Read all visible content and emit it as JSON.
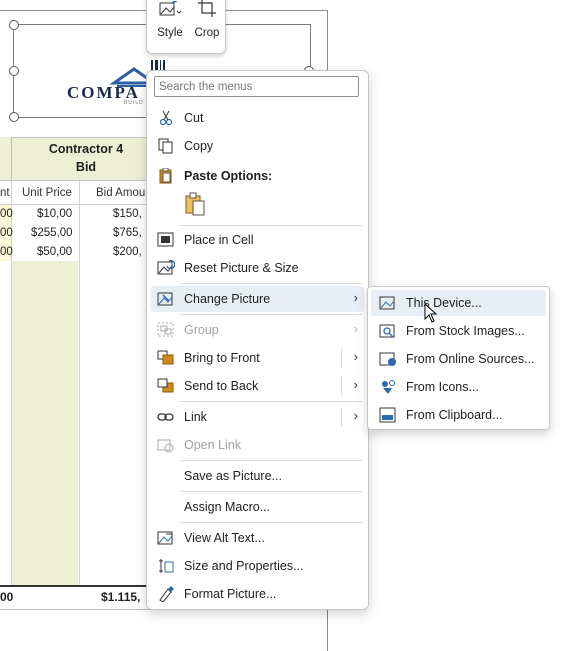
{
  "spreadsheet": {
    "contractor_header_line1": "Contractor 4",
    "contractor_header_line2": "Bid",
    "col_partial": "nt",
    "col_unit_price": "Unit Price",
    "col_bid_amount": "Bid Amou",
    "rows": [
      {
        "left": "00",
        "unit_price": "$10,00",
        "bid_amount": "$150,"
      },
      {
        "left": "00",
        "unit_price": "$255,00",
        "bid_amount": "$765,"
      },
      {
        "left": "00",
        "unit_price": "$50,00",
        "bid_amount": "$200,"
      }
    ],
    "total_left": "00",
    "total_bid": "$1.115,",
    "logo_text": "COMPA",
    "logo_tagline": "BUILD . RE"
  },
  "minibar": {
    "style_label": "Style",
    "crop_label": "Crop"
  },
  "menu": {
    "search_placeholder": "Search the menus",
    "items": {
      "cut": "Cut",
      "copy": "Copy",
      "paste_options": "Paste Options:",
      "place_in_cell": "Place in Cell",
      "reset_picture": "Reset Picture & Size",
      "change_picture": "Change Picture",
      "group": "Group",
      "bring_to_front": "Bring to Front",
      "send_to_back": "Send to Back",
      "link": "Link",
      "open_link": "Open Link",
      "save_as_picture": "Save as Picture...",
      "assign_macro": "Assign Macro...",
      "view_alt_text": "View Alt Text...",
      "size_and_properties": "Size and Properties...",
      "format_picture": "Format Picture..."
    }
  },
  "submenu": {
    "items": {
      "this_device": "This Device...",
      "stock_images": "From Stock Images...",
      "online_sources": "From Online Sources...",
      "icons": "From Icons...",
      "clipboard": "From Clipboard..."
    }
  },
  "colors": {
    "header_fill": "#eef0d6",
    "hover_fill": "#e8eef6",
    "icon_blue": "#2b6cb0",
    "icon_orange": "#d08a1a"
  }
}
